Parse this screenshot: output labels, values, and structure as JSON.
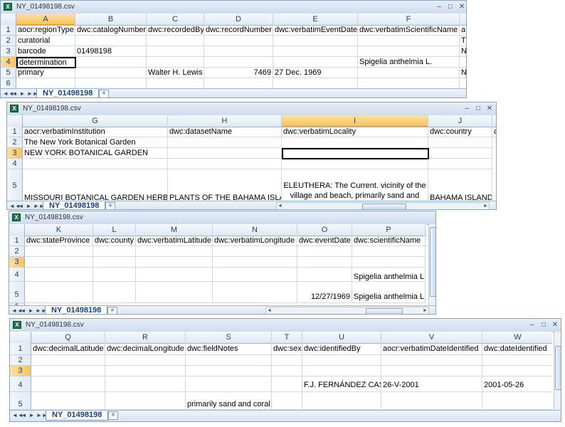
{
  "windows": [
    {
      "title": "NY_01498198.csv",
      "sheet_tab": "NY_01498198",
      "columns": [
        "A",
        "B",
        "C",
        "D",
        "E",
        "F"
      ],
      "rows": [
        {
          "num": "1",
          "cells": [
            "aocr:regionType",
            "dwc:catalogNumber",
            "dwc:recordedBy",
            "dwc:recordNumber",
            "dwc:verbatimEventDate",
            "dwc:verbatimScientificName"
          ]
        },
        {
          "num": "2",
          "cells": [
            "curatorial",
            "",
            "",
            "",
            "",
            ""
          ]
        },
        {
          "num": "3",
          "cells": [
            "barcode",
            "01498198",
            "",
            "",
            "",
            ""
          ]
        },
        {
          "num": "4",
          "cells": [
            "determination",
            "",
            "",
            "",
            "",
            "Spigelia anthelmia L."
          ]
        },
        {
          "num": "5",
          "cells": [
            "primary",
            "",
            "Walter H. Lewis",
            "7469",
            "27 Dec. 1969",
            ""
          ]
        },
        {
          "num": "6",
          "cells": [
            "",
            "",
            "",
            "",
            "",
            ""
          ]
        }
      ],
      "overflow": [
        "a",
        "T",
        "",
        "N",
        "",
        "N",
        ""
      ]
    },
    {
      "title": "NY_01498198.csv",
      "sheet_tab": "NY_01498198",
      "columns": [
        "G",
        "H",
        "I",
        "J"
      ],
      "rows": [
        {
          "num": "1",
          "cells": [
            "aocr:verbatimInstitution",
            "dwc:datasetName",
            "dwc:verbatimLocality",
            "dwc:country"
          ]
        },
        {
          "num": "2",
          "cells": [
            "The New York Botanical Garden",
            "",
            "",
            ""
          ]
        },
        {
          "num": "3",
          "cells": [
            "NEW YORK BOTANICAL GARDEN",
            "",
            "",
            ""
          ]
        },
        {
          "num": "4",
          "cells": [
            "",
            "",
            "",
            ""
          ]
        },
        {
          "num": "5",
          "cells": [
            "MISSOURI BOTANICAL GARDEN HERBARIUM",
            "PLANTS OF THE BAHAMA ISLANDS",
            "ELEUTHERA: The Current. vicinity of the village and beach, primarily sand and coral.",
            "BAHAMA ISLANDS"
          ]
        },
        {
          "num": "6",
          "cells": [
            "",
            "",
            "",
            ""
          ]
        }
      ],
      "overflow": [
        "c"
      ]
    },
    {
      "title": "NY_01498198.csv",
      "sheet_tab": "NY_01498198",
      "columns": [
        "K",
        "L",
        "M",
        "N",
        "O",
        "P"
      ],
      "rows": [
        {
          "num": "1",
          "cells": [
            "dwc:stateProvince",
            "dwc:county",
            "dwc:verbatimLatitude",
            "dwc:verbatimLongitude",
            "dwc:eventDate",
            "dwc:scientificName"
          ]
        },
        {
          "num": "2",
          "cells": [
            "",
            "",
            "",
            "",
            "",
            ""
          ]
        },
        {
          "num": "3",
          "cells": [
            "",
            "",
            "",
            "",
            "",
            ""
          ]
        },
        {
          "num": "4",
          "cells": [
            "",
            "",
            "",
            "",
            "",
            "Spigelia anthelmia L."
          ]
        },
        {
          "num": "5",
          "cells": [
            "",
            "",
            "",
            "",
            "12/27/1969",
            "Spigelia anthelmia L."
          ]
        },
        {
          "num": "6",
          "cells": [
            "",
            "",
            "",
            "",
            "",
            ""
          ]
        }
      ],
      "overflow": [
        "d"
      ]
    },
    {
      "title": "NY_01498198.csv",
      "sheet_tab": "NY_01498198",
      "columns": [
        "Q",
        "R",
        "S",
        "T",
        "U",
        "V",
        "W"
      ],
      "rows": [
        {
          "num": "1",
          "cells": [
            "dwc:decimalLatitude",
            "dwc:decimalLongitude",
            "dwc:fieldNotes",
            "dwc:sex",
            "dwc:identifiedBy",
            "aocr:verbatimDateIdentified",
            "dwc:dateIdentified"
          ]
        },
        {
          "num": "2",
          "cells": [
            "",
            "",
            "",
            "",
            "",
            "",
            ""
          ]
        },
        {
          "num": "3",
          "cells": [
            "",
            "",
            "",
            "",
            "",
            "",
            ""
          ]
        },
        {
          "num": "4",
          "cells": [
            "",
            "",
            "",
            "",
            "F.J. FERNÁNDEZ CASAS",
            "26-V-2001",
            "2001-05-26"
          ]
        },
        {
          "num": "5",
          "cells": [
            "",
            "",
            "primarily sand and coral.",
            "",
            "",
            "",
            ""
          ]
        }
      ]
    }
  ],
  "buttons": {
    "minimize": "–",
    "restore": "□",
    "close": "✕"
  },
  "nav": {
    "first": "◄◄",
    "prev": "◄",
    "next": "►",
    "last": "►►"
  },
  "colors": {
    "header_selected": "#f8c25c",
    "title_bar": "#dbe6f4",
    "sheet_tab_text": "#15428b"
  }
}
